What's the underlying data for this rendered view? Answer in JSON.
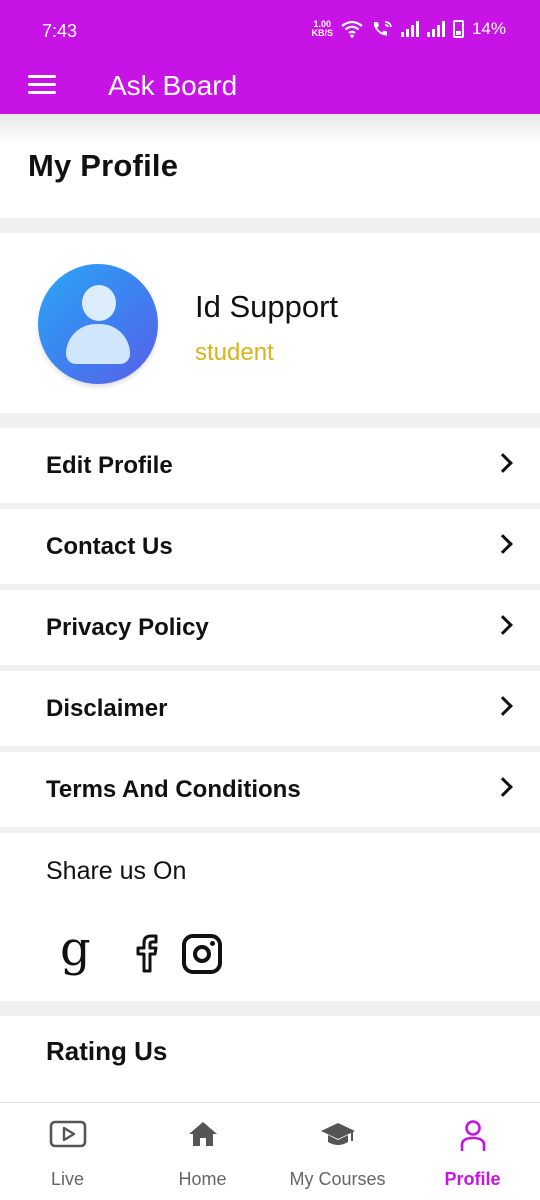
{
  "status_bar": {
    "time": "7:43",
    "net_speed_value": "1.00",
    "net_speed_unit": "KB/S",
    "battery": "14%"
  },
  "app_bar": {
    "title": "Ask Board",
    "menu_icon": "hamburger-menu-icon"
  },
  "page": {
    "title": "My Profile"
  },
  "profile": {
    "name": "Id Support",
    "role": "student",
    "role_color": "#d9b31a"
  },
  "menu": {
    "items": [
      {
        "label": "Edit Profile"
      },
      {
        "label": "Contact Us"
      },
      {
        "label": "Privacy Policy"
      },
      {
        "label": "Disclaimer"
      },
      {
        "label": "Terms And Conditions"
      }
    ]
  },
  "share": {
    "title": "Share us On",
    "google_glyph": "g",
    "icons": [
      "google-icon",
      "facebook-icon",
      "instagram-icon"
    ]
  },
  "rating": {
    "title": "Rating Us"
  },
  "bottom_nav": {
    "items": [
      {
        "label": "Live",
        "icon": "play-video-icon"
      },
      {
        "label": "Home",
        "icon": "home-icon"
      },
      {
        "label": "My Courses",
        "icon": "graduation-cap-icon"
      },
      {
        "label": "Profile",
        "icon": "person-icon",
        "active": true
      }
    ]
  },
  "colors": {
    "brand": "#c813e6",
    "active_nav": "#c813e6"
  }
}
